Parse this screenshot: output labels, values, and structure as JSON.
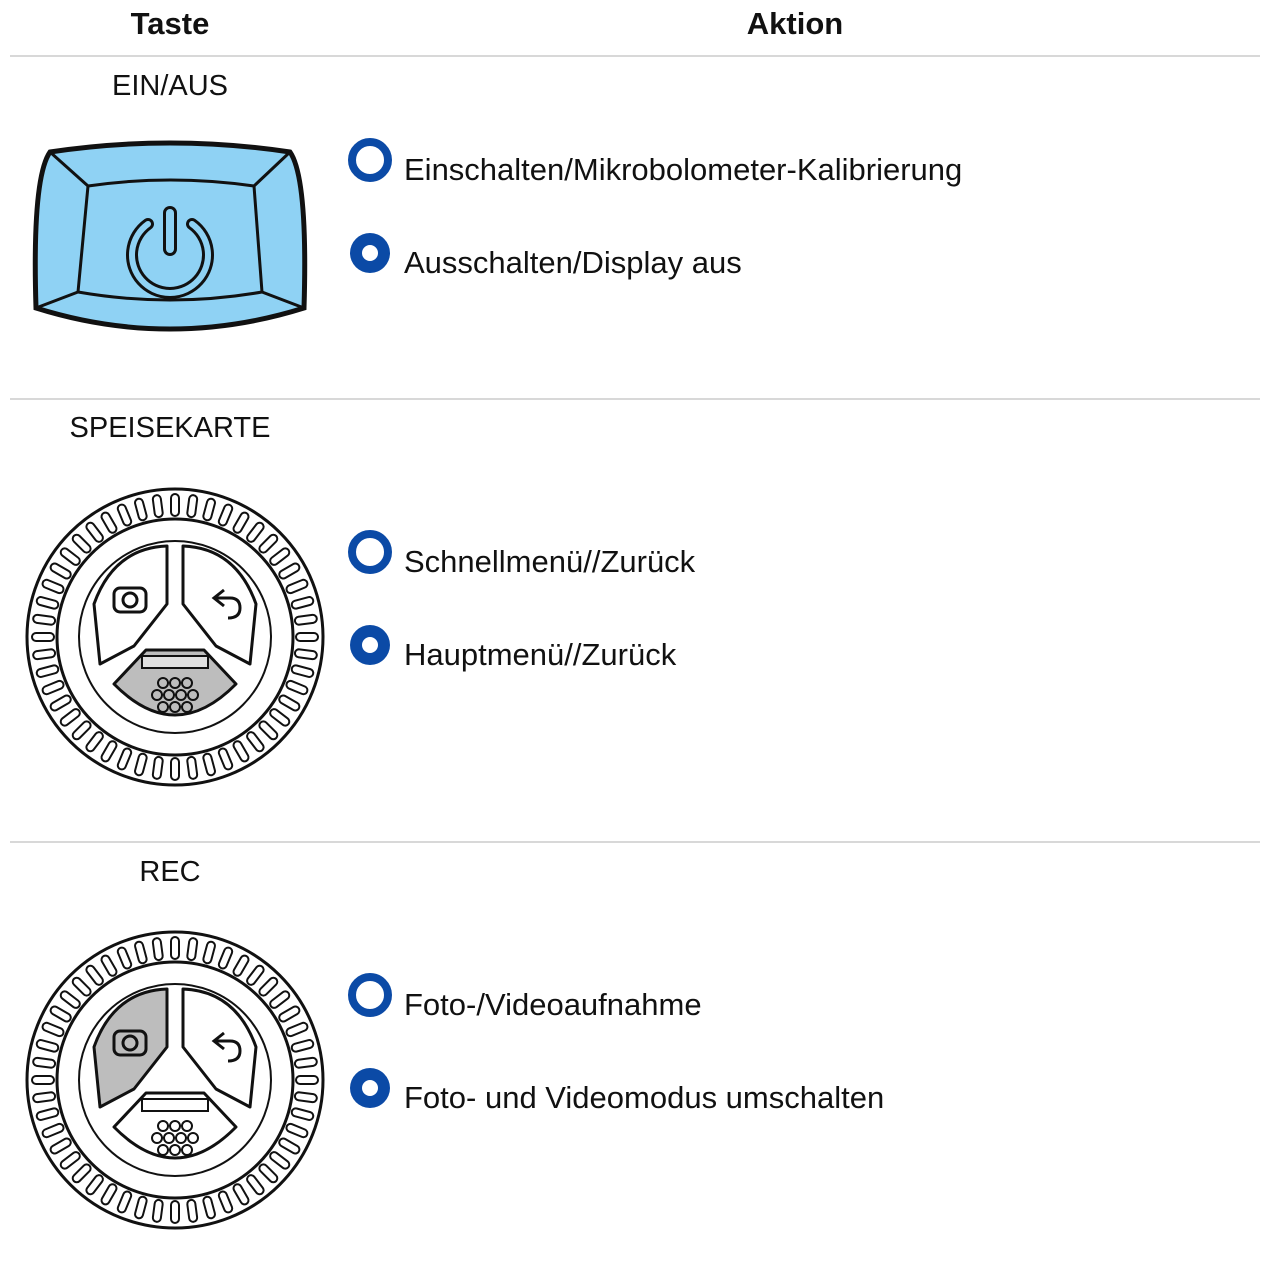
{
  "header": {
    "col_key": "Taste",
    "col_action": "Aktion"
  },
  "rows": [
    {
      "key": "EIN/AUS",
      "button_icon": "power-button-icon",
      "actions": [
        {
          "press": "short",
          "text": "Einschalten/Mikrobolometer-Kalibrierung"
        },
        {
          "press": "long",
          "text": "Ausschalten/Display aus"
        }
      ]
    },
    {
      "key": "SPEISEKARTE",
      "button_icon": "menu-dial-icon",
      "actions": [
        {
          "press": "short",
          "text": "Schnellmenü//Zurück"
        },
        {
          "press": "long",
          "text": "Hauptmenü//Zurück"
        }
      ]
    },
    {
      "key": "REC",
      "button_icon": "rec-dial-icon",
      "actions": [
        {
          "press": "short",
          "text": "Foto-/Videoaufnahme"
        },
        {
          "press": "long",
          "text": "Foto- und Videomodus umschalten"
        }
      ]
    }
  ],
  "colors": {
    "accent_blue": "#0b4aa6",
    "power_button_fill": "#8fd2f4",
    "highlight_grey": "#bdbdbd"
  }
}
